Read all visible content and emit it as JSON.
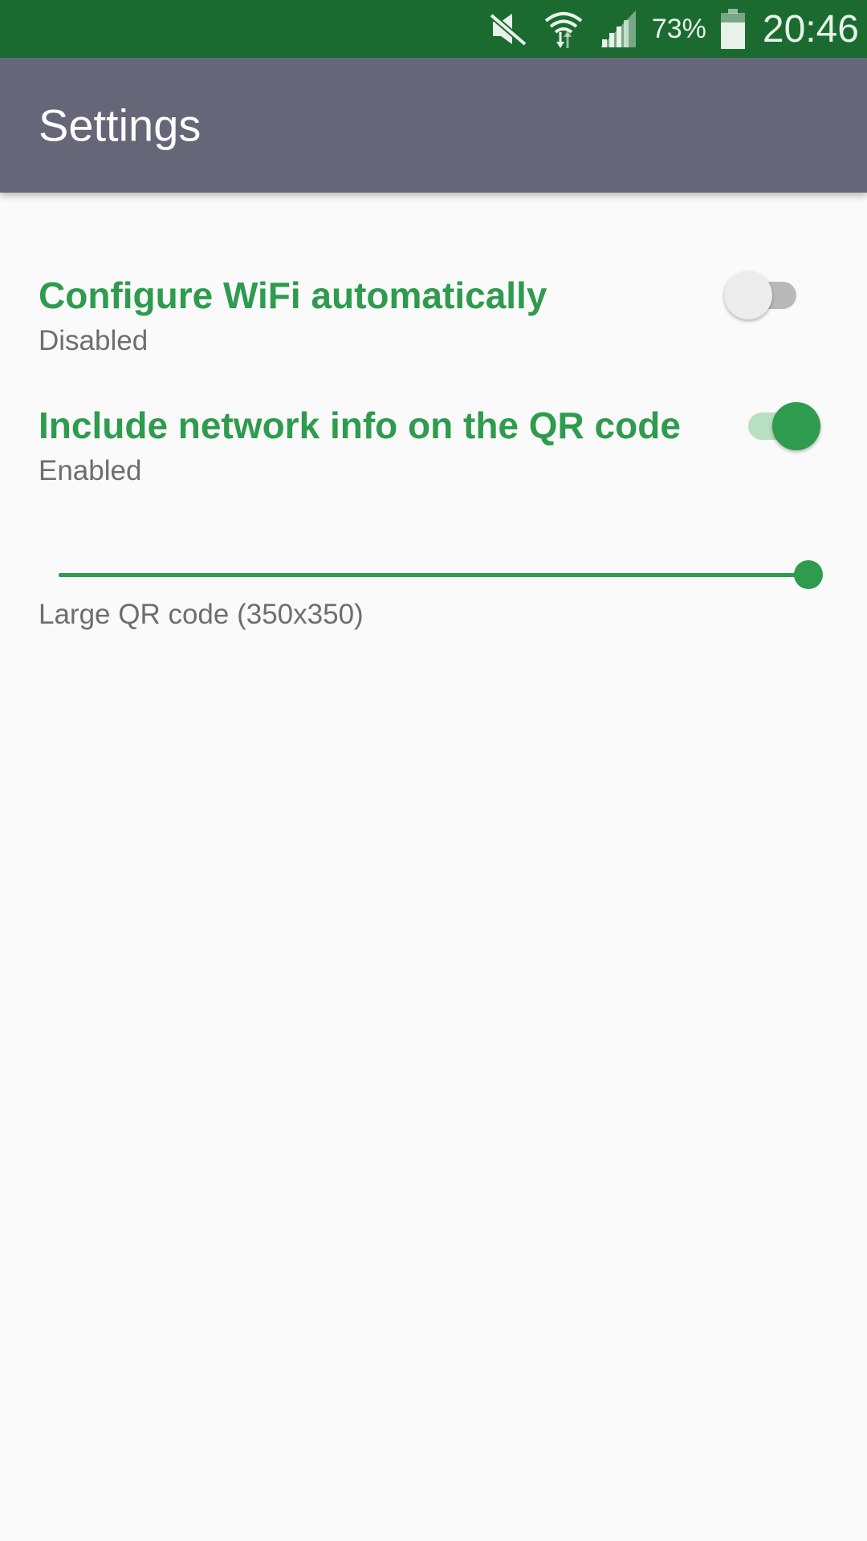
{
  "status_bar": {
    "battery": "73%",
    "time": "20:46",
    "icons": [
      "mute-icon",
      "wifi-icon",
      "signal-icon",
      "battery-icon"
    ]
  },
  "app_bar": {
    "title": "Settings"
  },
  "preferences": [
    {
      "title": "Configure WiFi automatically",
      "summary": "Disabled",
      "enabled": false
    },
    {
      "title": "Include network info on the QR code",
      "summary": "Enabled",
      "enabled": true
    }
  ],
  "qr_size": {
    "label": "Large QR code (350x350)",
    "value_fraction": 1.0
  },
  "colors": {
    "status_bar": "#1b6b31",
    "app_bar": "#656779",
    "accent": "#2e9b4e"
  }
}
